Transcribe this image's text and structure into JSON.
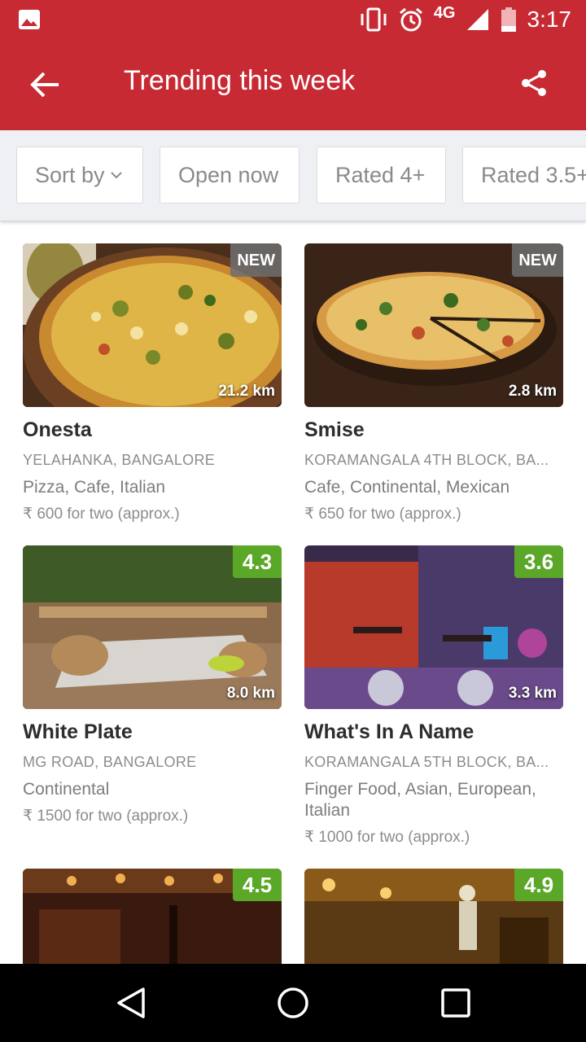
{
  "status_bar": {
    "network": "4G",
    "time": "3:17",
    "icons": [
      "gallery-icon",
      "vibrate-icon",
      "alarm-icon",
      "signal-icon",
      "battery-icon"
    ]
  },
  "app_bar": {
    "title": "Trending this week",
    "back_icon": "arrow-left-icon",
    "share_icon": "share-icon",
    "color": "#c72a33"
  },
  "filters": [
    {
      "label": "Sort by"
    },
    {
      "label": "Open now"
    },
    {
      "label": "Rated 4+"
    },
    {
      "label": "Rated 3.5+"
    }
  ],
  "restaurants": [
    {
      "name": "Onesta",
      "location": "YELAHANKA, BANGALORE",
      "cuisine": "Pizza, Cafe, Italian",
      "cost": "₹ 600 for two (approx.)",
      "badge": "NEW",
      "distance": "21.2 km"
    },
    {
      "name": "Smise",
      "location": "KORAMANGALA 4TH BLOCK, BA...",
      "cuisine": "Cafe, Continental, Mexican",
      "cost": "₹ 650 for two (approx.)",
      "badge": "NEW",
      "distance": "2.8 km"
    },
    {
      "name": "White Plate",
      "location": "MG ROAD, BANGALORE",
      "cuisine": "Continental",
      "cost": "₹ 1500 for two (approx.)",
      "badge": "4.3",
      "distance": "8.0 km"
    },
    {
      "name": "What's In A Name",
      "location": "KORAMANGALA 5TH BLOCK, BA...",
      "cuisine": "Finger Food, Asian, European, Italian",
      "cost": "₹ 1000 for two (approx.)",
      "badge": "3.6",
      "distance": "3.3 km"
    },
    {
      "badge": "4.5"
    },
    {
      "badge": "4.9"
    }
  ],
  "colors": {
    "rating_green": "#5ba829",
    "new_badge": "#6e6e6e"
  }
}
